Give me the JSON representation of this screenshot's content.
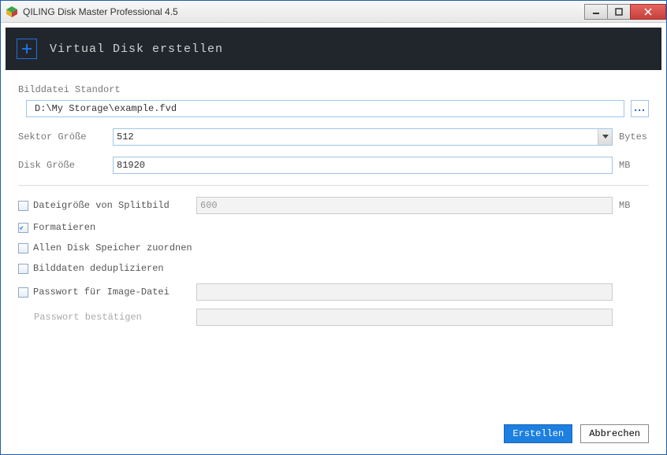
{
  "window": {
    "title": "QILING Disk Master Professional 4.5"
  },
  "header": {
    "title": "Virtual Disk erstellen"
  },
  "fields": {
    "location_label": "Bilddatei Standort",
    "location_value": "D:\\My Storage\\example.fvd",
    "sector_label": "Sektor Größe",
    "sector_value": "512",
    "sector_unit": "Bytes",
    "disk_size_label": "Disk Größe",
    "disk_size_value": "81920",
    "disk_size_unit": "MB",
    "split_label": "Dateigröße von Splitbild",
    "split_value": "600",
    "split_unit": "MB",
    "format_label": "Formatieren",
    "allocate_label": "Allen Disk Speicher zuordnen",
    "dedup_label": "Bilddaten deduplizieren",
    "password_label": "Passwort für Image-Datei",
    "password_confirm_label": "Passwort bestätigen"
  },
  "checkboxes": {
    "split": false,
    "format": true,
    "allocate": false,
    "dedup": false,
    "password": false
  },
  "buttons": {
    "create": "Erstellen",
    "cancel": "Abbrechen",
    "browse": "..."
  }
}
